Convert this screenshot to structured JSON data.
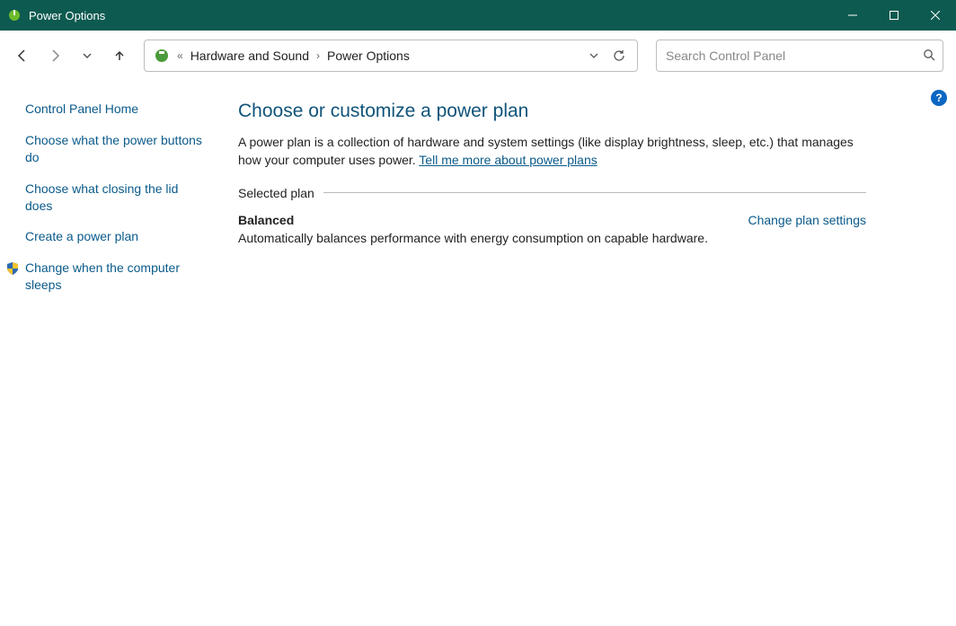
{
  "window": {
    "title": "Power Options"
  },
  "breadcrumb": {
    "parent": "Hardware and Sound",
    "current": "Power Options"
  },
  "search": {
    "placeholder": "Search Control Panel"
  },
  "sidebar": {
    "home": "Control Panel Home",
    "links": [
      "Choose what the power buttons do",
      "Choose what closing the lid does",
      "Create a power plan",
      "Change when the computer sleeps"
    ]
  },
  "main": {
    "heading": "Choose or customize a power plan",
    "description_pre": "A power plan is a collection of hardware and system settings (like display brightness, sleep, etc.) that manages how your computer uses power. ",
    "description_link": "Tell me more about power plans",
    "section_label": "Selected plan",
    "plan": {
      "name": "Balanced",
      "change_link": "Change plan settings",
      "description": "Automatically balances performance with energy consumption on capable hardware."
    }
  },
  "help": "?"
}
